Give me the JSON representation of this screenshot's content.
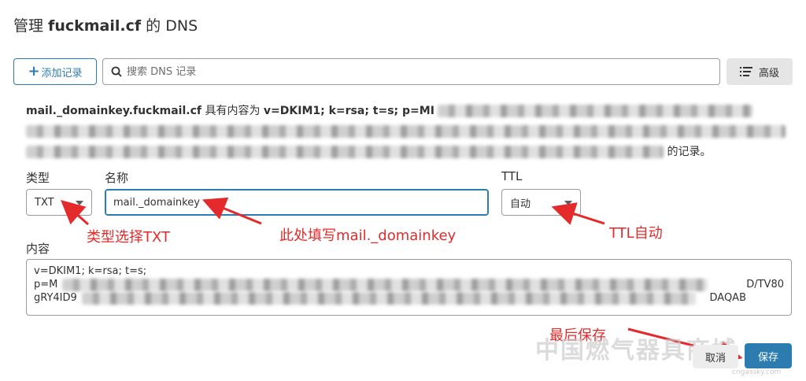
{
  "header": {
    "prefix": "管理 ",
    "domain": "fuckmail.cf",
    "suffix": " 的 DNS"
  },
  "toolbar": {
    "add_record": "添加记录",
    "search_placeholder": "搜索 DNS 记录",
    "advanced": "高级"
  },
  "notice": {
    "record_name": "mail._domainkey.fuckmail.cf",
    "has_content": " 具有内容为 ",
    "content_value": "v=DKIM1; k=rsa; t=s; p=MI",
    "tail_visible": "",
    "ending": "的记录。"
  },
  "form": {
    "type_label": "类型",
    "type_value": "TXT",
    "name_label": "名称",
    "name_value": "mail._domainkey",
    "ttl_label": "TTL",
    "ttl_value": "自动",
    "content_label": "内容",
    "content_lines": {
      "line1": "v=DKIM1; k=rsa; t=s;",
      "line2_start": "p=M",
      "line2_end": "D/TV80",
      "line3_start": "gRY4ID9",
      "line3_end": "DAQAB"
    }
  },
  "annotations": {
    "type_note": "类型选择TXT",
    "name_note": "此处填写mail._domainkey",
    "ttl_note": "TTL自动",
    "save_note": "最后保存"
  },
  "actions": {
    "cancel": "取消",
    "save": "保存"
  },
  "watermark": {
    "main": "中国燃气器具商城",
    "sub": "cngassky.com"
  },
  "colors": {
    "accent": "#2c7cb0",
    "annotation": "#e42a2a"
  }
}
